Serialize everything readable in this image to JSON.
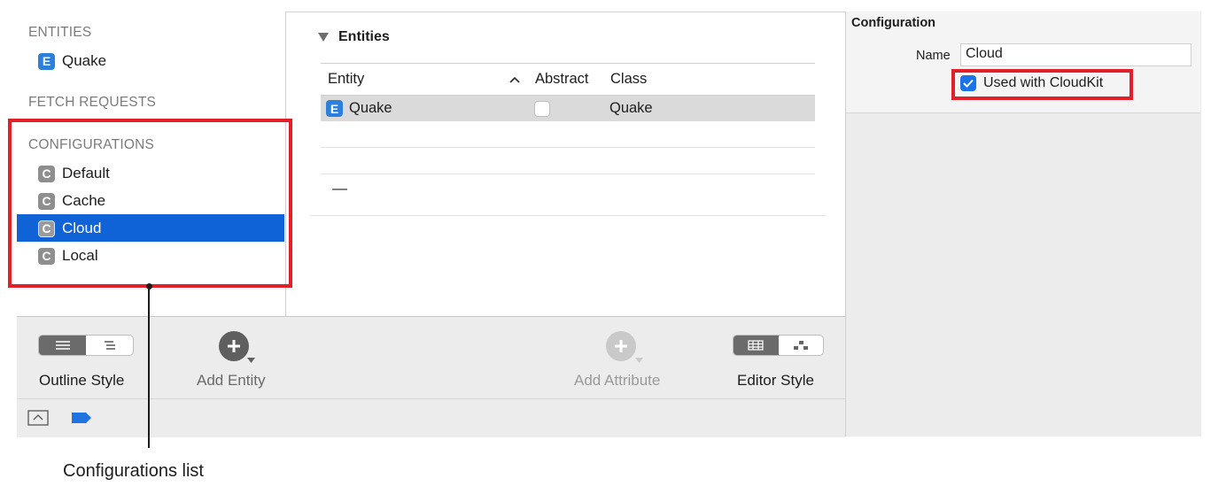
{
  "sidebar": {
    "entities_header": "ENTITIES",
    "entities": [
      {
        "badge": "E",
        "label": "Quake"
      }
    ],
    "fetch_header": "FETCH REQUESTS",
    "config_header": "CONFIGURATIONS",
    "configurations": [
      {
        "badge": "C",
        "label": "Default"
      },
      {
        "badge": "C",
        "label": "Cache"
      },
      {
        "badge": "C",
        "label": "Cloud",
        "selected": true
      },
      {
        "badge": "C",
        "label": "Local"
      }
    ]
  },
  "main": {
    "section_title": "Entities",
    "columns": {
      "entity": "Entity",
      "sort_indicator": "^",
      "abstract": "Abstract",
      "class": "Class"
    },
    "rows": [
      {
        "badge": "E",
        "entity": "Quake",
        "abstract": false,
        "class": "Quake"
      }
    ],
    "add_row_placeholder": "—"
  },
  "toolbar": {
    "outline_style": "Outline Style",
    "add_entity": "Add Entity",
    "add_attribute": "Add Attribute",
    "editor_style": "Editor Style"
  },
  "inspector": {
    "title": "Configuration",
    "name_label": "Name",
    "name_value": "Cloud",
    "cloudkit_label": "Used with CloudKit",
    "cloudkit_checked": true
  },
  "callout": {
    "label": "Configurations list"
  },
  "colors": {
    "selection": "#0f63d6",
    "highlight": "#e3202a",
    "entity_badge": "#2d7fdc",
    "config_badge": "#8e8e8e"
  }
}
